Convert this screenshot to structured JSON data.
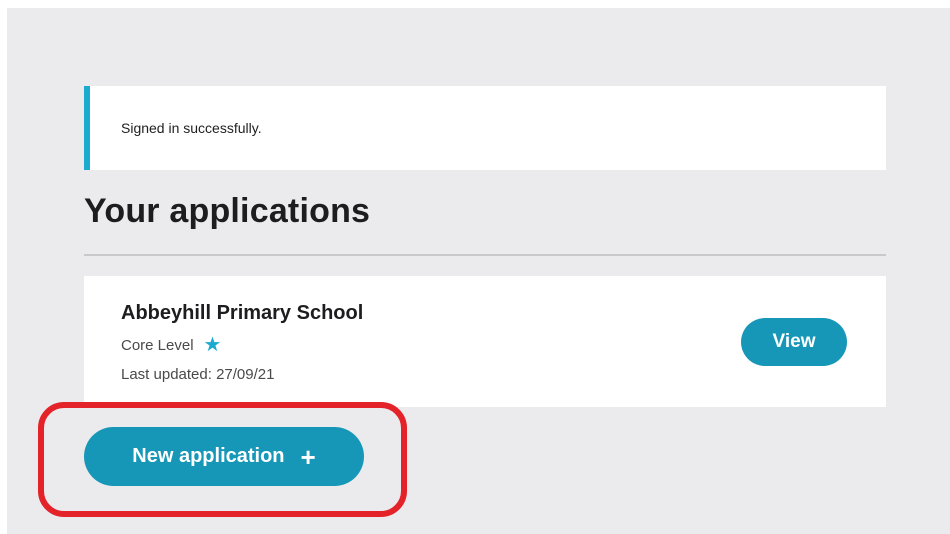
{
  "flash": {
    "message": "Signed in successfully."
  },
  "page": {
    "title": "Your applications"
  },
  "applications": [
    {
      "name": "Abbeyhill Primary School",
      "level": "Core Level",
      "level_icon": "star-icon",
      "last_updated": "Last updated: 27/09/21",
      "view_label": "View"
    }
  ],
  "actions": {
    "new_application_label": "New application",
    "new_application_icon": "plus-icon"
  },
  "colors": {
    "accent": "#1697b7",
    "flash_border": "#1aabce",
    "highlight": "#e32329",
    "background": "#ebebed"
  }
}
